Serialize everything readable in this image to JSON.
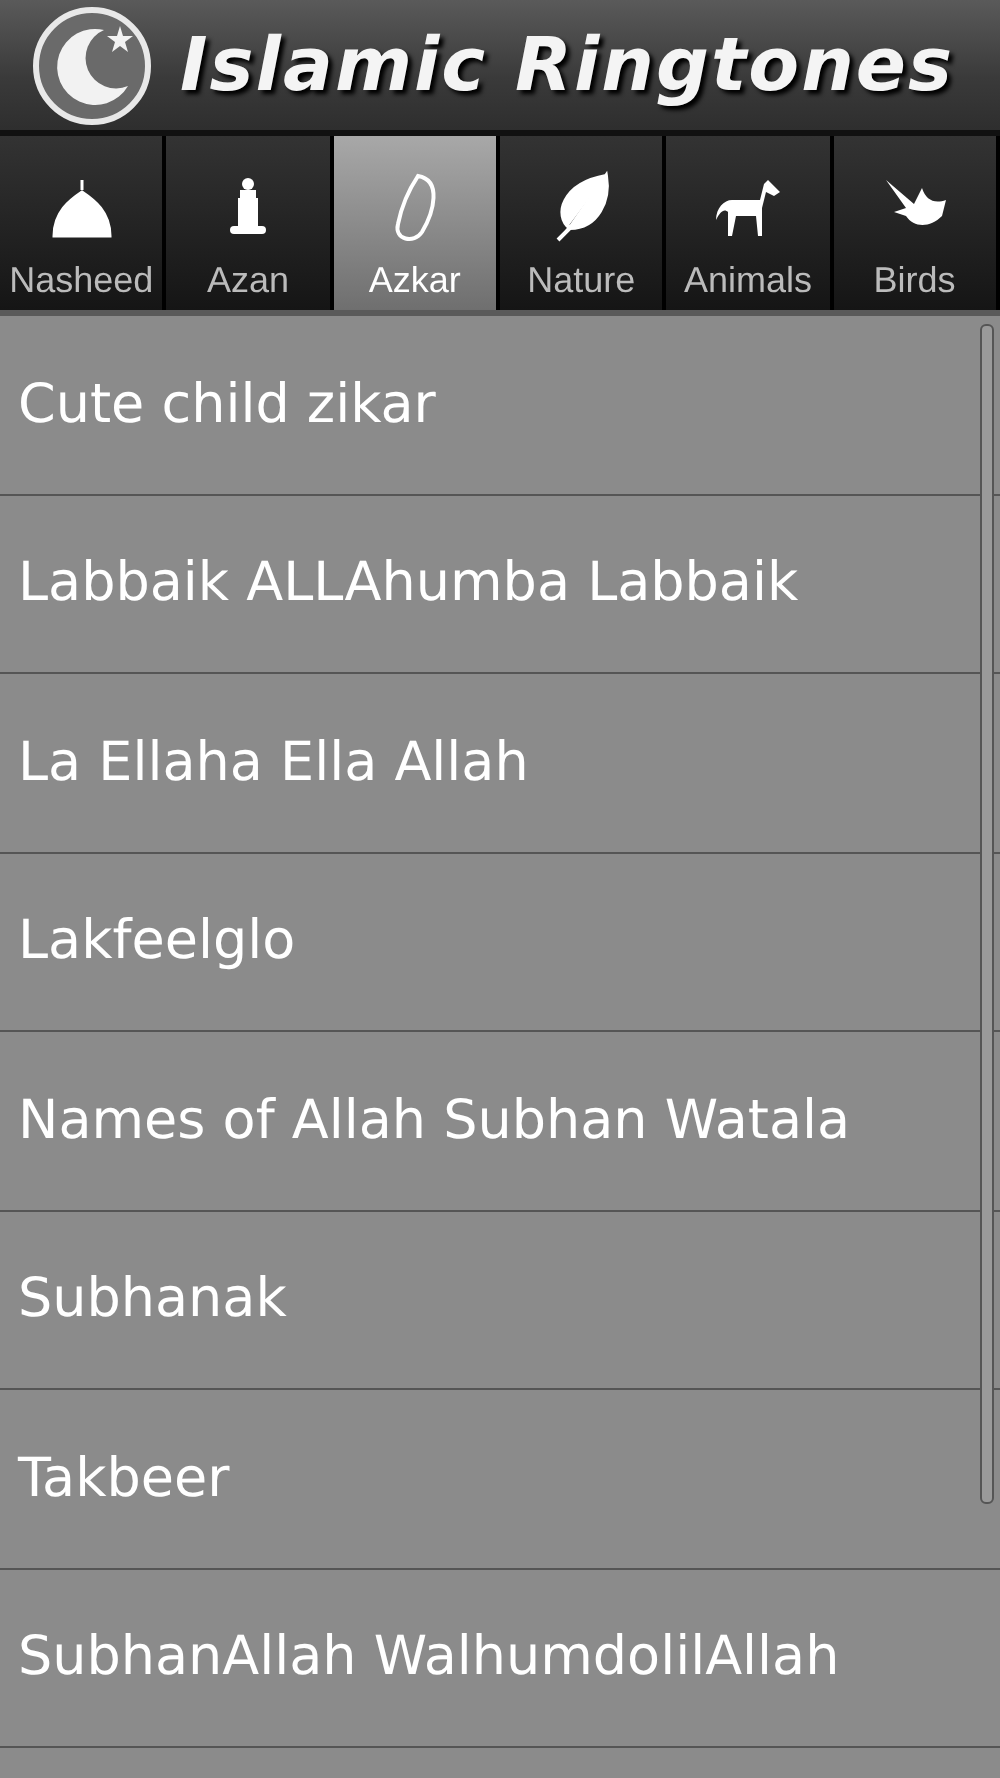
{
  "header": {
    "title": "Islamic Ringtones"
  },
  "tabs": [
    {
      "label": "Nasheed",
      "selected": false
    },
    {
      "label": "Azan",
      "selected": false
    },
    {
      "label": "Azkar",
      "selected": true
    },
    {
      "label": "Nature",
      "selected": false
    },
    {
      "label": "Animals",
      "selected": false
    },
    {
      "label": "Birds",
      "selected": false
    }
  ],
  "ringtones": [
    "Cute child zikar",
    "Labbaik ALLAhumba Labbaik",
    "La Ellaha Ella Allah",
    "Lakfeelglo",
    "Names of Allah Subhan Watala",
    "Subhanak",
    "Takbeer",
    "SubhanAllah WalhumdolilAllah"
  ]
}
